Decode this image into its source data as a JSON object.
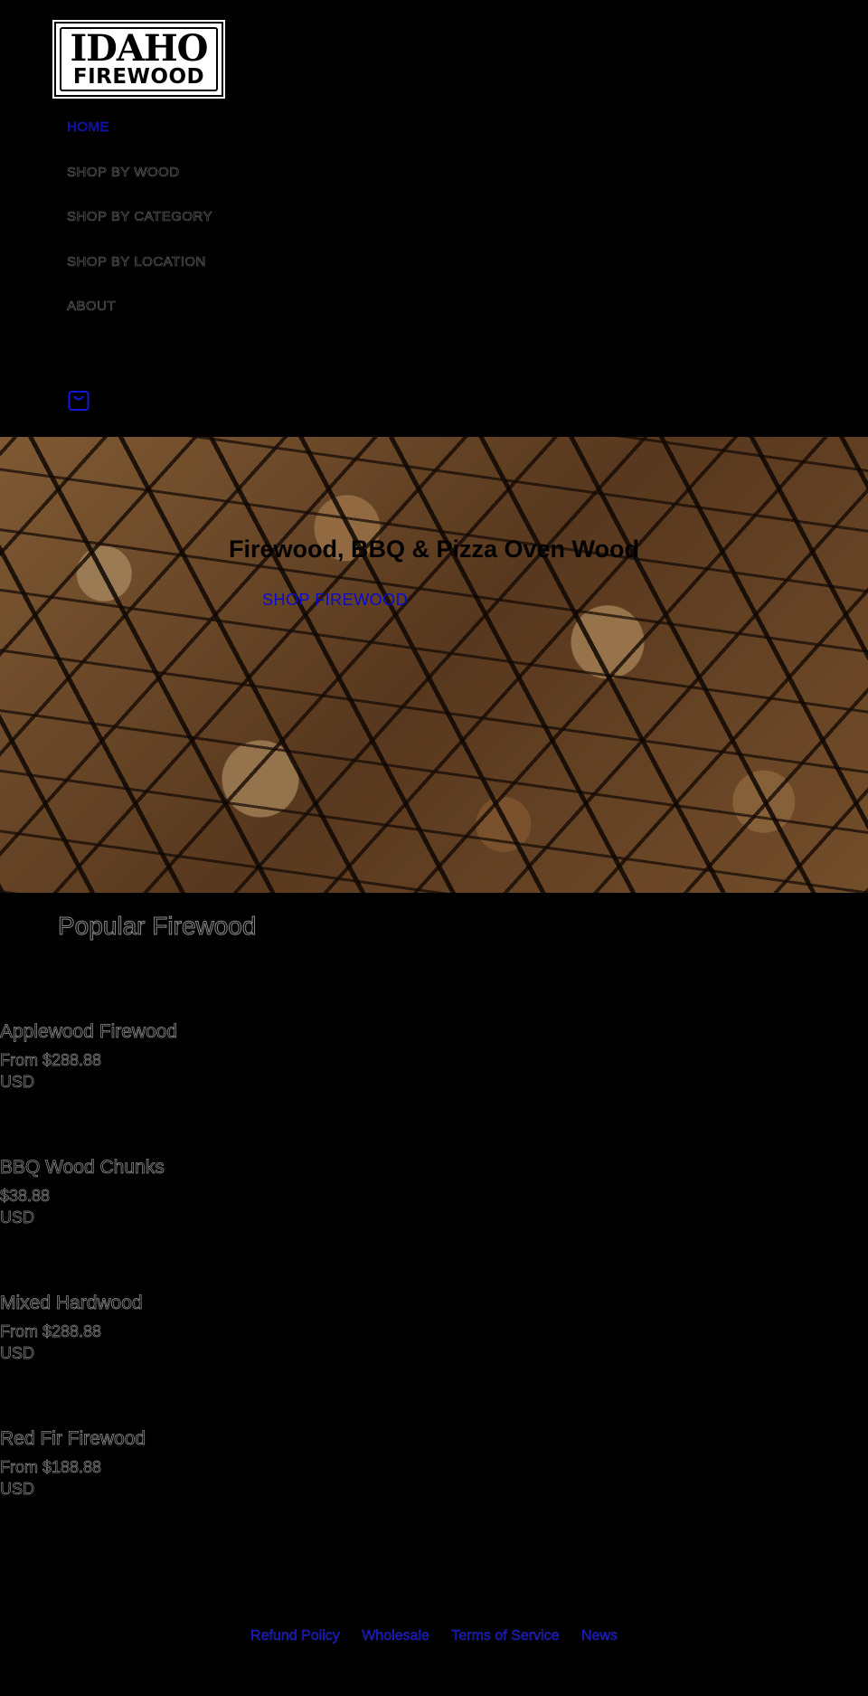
{
  "header": {
    "logo": {
      "line1": "IDAHO",
      "line2": "FIREWOOD"
    },
    "nav": [
      {
        "label": "HOME",
        "active": true
      },
      {
        "label": "SHOP BY WOOD",
        "active": false
      },
      {
        "label": "SHOP BY CATEGORY",
        "active": false
      },
      {
        "label": "SHOP BY LOCATION",
        "active": false
      },
      {
        "label": "ABOUT",
        "active": false
      }
    ],
    "cart_icon": "shopping-bag-icon"
  },
  "hero": {
    "title": "Firewood, BBQ & Pizza Oven Wood",
    "button_label": "SHOP FIREWOOD"
  },
  "popular": {
    "title": "Popular Firewood",
    "products": [
      {
        "name": "Applewood Firewood",
        "price": "From $288.88",
        "currency": "USD"
      },
      {
        "name": "BBQ Wood Chunks",
        "price": "$38.88",
        "currency": "USD"
      },
      {
        "name": "Mixed Hardwood",
        "price": "From $288.88",
        "currency": "USD"
      },
      {
        "name": "Red Fir Firewood",
        "price": "From $188.88",
        "currency": "USD"
      }
    ]
  },
  "footer": {
    "links": [
      "Refund Policy",
      "Wholesale",
      "Terms of Service",
      "News"
    ]
  },
  "colors": {
    "background": "#000000",
    "link_blue": "#0a0ad0"
  }
}
